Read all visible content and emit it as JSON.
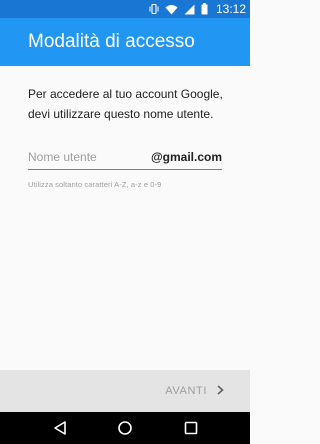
{
  "status_bar": {
    "time": "13:12",
    "icons": [
      "vibrate-icon",
      "wifi-icon",
      "signal-icon",
      "battery-icon"
    ]
  },
  "app_bar": {
    "title": "Modalità di accesso",
    "color": "#2196f3",
    "status_color": "#1976d2"
  },
  "instruction": "Per accedere al tuo account Google, devi utilizzare questo nome utente.",
  "username_field": {
    "value": "",
    "placeholder": "Nome utente",
    "suffix": "@gmail.com",
    "hint": "Utilizza soltanto caratteri A-Z, a-z e 0-9"
  },
  "footer": {
    "next_label": "AVANTI",
    "next_icon": "chevron-right-icon"
  },
  "nav_bar": {
    "buttons": [
      "back-icon",
      "home-icon",
      "recents-icon"
    ]
  }
}
